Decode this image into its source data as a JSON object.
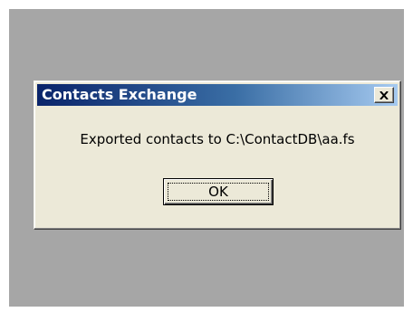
{
  "dialog": {
    "title": "Contacts Exchange",
    "message": "Exported contacts to C:\\ContactDB\\aa.fs",
    "ok_label": "OK",
    "close_icon": "close-icon"
  },
  "colors": {
    "desktop": "#a6a6a6",
    "dialog_face": "#ece9d8",
    "titlebar_start": "#0a246a",
    "titlebar_end": "#a6caf0",
    "title_text": "#ffffff"
  }
}
